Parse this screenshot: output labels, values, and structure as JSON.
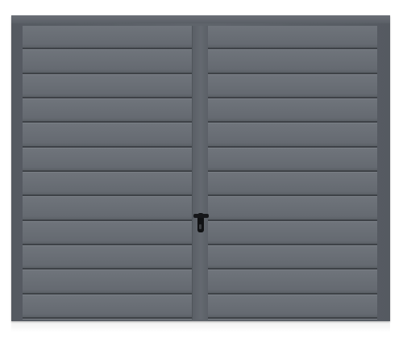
{
  "scene": {
    "subject": "garage-door",
    "colors": {
      "background": "#ffffff",
      "door": "#666b72",
      "frame": "#5a5f66",
      "groove": "#3e4247",
      "handle": "#111214"
    },
    "leaves": 2,
    "panels_per_leaf": 12
  }
}
